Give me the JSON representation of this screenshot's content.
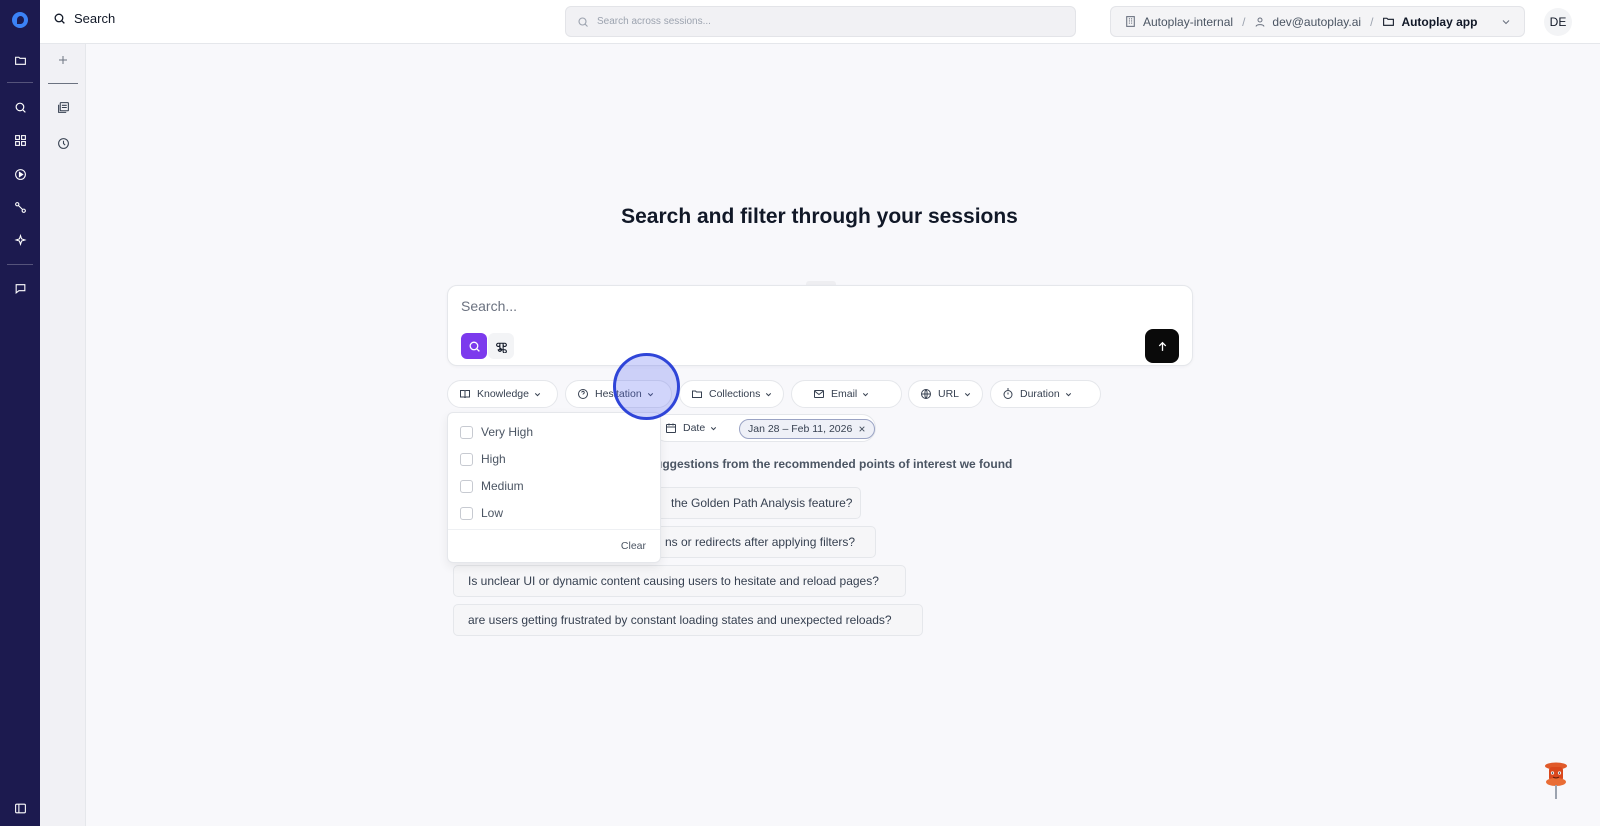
{
  "topbar": {
    "page_title": "Search",
    "global_search_placeholder": "Search across sessions...",
    "org": "Autoplay-internal",
    "user": "dev@autoplay.ai",
    "project": "Autoplay app",
    "avatar_initials": "DE"
  },
  "rail": {
    "icons": [
      "logo-icon",
      "folder-icon",
      "search-icon",
      "dashboard-icon",
      "play-circle-icon",
      "flow-icon",
      "sparkle-icon",
      "chat-icon",
      "sidebar-toggle-icon"
    ]
  },
  "side": {
    "icons": [
      "plus-icon",
      "sessions-icon",
      "history-icon"
    ]
  },
  "main": {
    "headline": "Search and filter through your sessions",
    "search_placeholder": "Search...",
    "filters": [
      {
        "label": "Knowledge",
        "icon": "book-icon"
      },
      {
        "label": "Hesitation",
        "icon": "help-circle-icon"
      },
      {
        "label": "Collections",
        "icon": "folder-icon"
      },
      {
        "label": "Email",
        "icon": "mail-icon"
      },
      {
        "label": "URL",
        "icon": "globe-icon"
      },
      {
        "label": "Duration",
        "icon": "timer-icon"
      },
      {
        "label": "Date",
        "icon": "calendar-icon"
      }
    ],
    "date_range": "Jan 28 – Feb 11, 2026",
    "suggestions_header_visible": "ch suggestions from the recommended points of interest we found",
    "suggestions_visible": [
      "the Golden Path Analysis feature?",
      "ns or redirects after applying filters?",
      "Is unclear UI or dynamic content causing users to hesitate and reload pages?",
      "are users getting frustrated by constant loading states and unexpected reloads?"
    ]
  },
  "dropdown": {
    "options": [
      "Very High",
      "High",
      "Medium",
      "Low"
    ],
    "clear_label": "Clear"
  },
  "colors": {
    "rail": "#1c1a4f",
    "accent_purple": "#7c3aed",
    "cursor": "#2f45d8"
  }
}
